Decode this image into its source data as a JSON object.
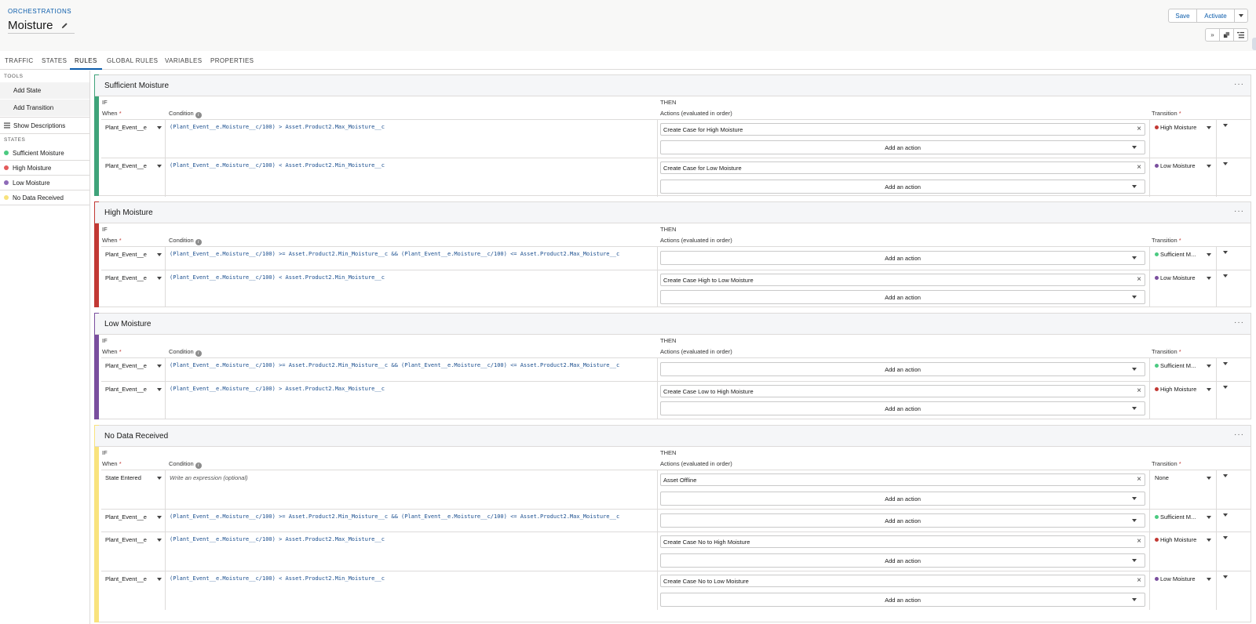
{
  "header": {
    "breadcrumb": "ORCHESTRATIONS",
    "title": "Moisture",
    "save_label": "Save",
    "activate_label": "Activate"
  },
  "tabs": [
    {
      "label": "TRAFFIC"
    },
    {
      "label": "STATES"
    },
    {
      "label": "RULES"
    },
    {
      "label": "GLOBAL RULES"
    },
    {
      "label": "VARIABLES"
    },
    {
      "label": "PROPERTIES"
    }
  ],
  "sidebar": {
    "tools_heading": "TOOLS",
    "add_state": "Add State",
    "add_transition": "Add Transition",
    "show_descriptions": "Show Descriptions",
    "states_heading": "STATES",
    "states": [
      {
        "label": "Sufficient Moisture",
        "color": "#4bca81"
      },
      {
        "label": "High Moisture",
        "color": "#e35b5b"
      },
      {
        "label": "Low Moisture",
        "color": "#8e6bb8"
      },
      {
        "label": "No Data Received",
        "color": "#f8e27b"
      }
    ]
  },
  "labels": {
    "if": "IF",
    "then": "THEN",
    "when": "When",
    "condition": "Condition",
    "actions": "Actions (evaluated in order)",
    "transition": "Transition",
    "add_action": "Add an action",
    "required": "*"
  },
  "colors": {
    "sufficient": "#3fa37a",
    "high": "#c23934",
    "low": "#7a4f9e",
    "nodata": "#f9e37d",
    "accent": "#0b5cab"
  },
  "cards": [
    {
      "title": "Sufficient Moisture",
      "rules": [
        {
          "when": "Plant_Event__e",
          "condition": "(Plant_Event__e.Moisture__c/100) > Asset.Product2.Max_Moisture__c",
          "action": "Create Case for High Moisture",
          "transition": "High Moisture"
        },
        {
          "when": "Plant_Event__e",
          "condition": "(Plant_Event__e.Moisture__c/100) < Asset.Product2.Min_Moisture__c",
          "action": "Create Case for Low Moisture",
          "transition": "Low Moisture"
        }
      ]
    },
    {
      "title": "High Moisture",
      "rules": [
        {
          "when": "Plant_Event__e",
          "condition": "(Plant_Event__e.Moisture__c/100) >= Asset.Product2.Min_Moisture__c && (Plant_Event__e.Moisture__c/100) <= Asset.Product2.Max_Moisture__c",
          "action": "",
          "transition": "Sufficient M..."
        },
        {
          "when": "Plant_Event__e",
          "condition": "(Plant_Event__e.Moisture__c/100) < Asset.Product2.Min_Moisture__c",
          "action": "Create Case High to Low Moisture",
          "transition": "Low Moisture"
        }
      ]
    },
    {
      "title": "Low Moisture",
      "rules": [
        {
          "when": "Plant_Event__e",
          "condition": "(Plant_Event__e.Moisture__c/100) >= Asset.Product2.Min_Moisture__c && (Plant_Event__e.Moisture__c/100) <= Asset.Product2.Max_Moisture__c",
          "action": "",
          "transition": "Sufficient M..."
        },
        {
          "when": "Plant_Event__e",
          "condition": "(Plant_Event__e.Moisture__c/100) > Asset.Product2.Max_Moisture__c",
          "action": "Create Case Low to High Moisture",
          "transition": "High Moisture"
        }
      ]
    },
    {
      "title": "No Data Received",
      "rules": [
        {
          "when": "State Entered",
          "condition": "",
          "condition_placeholder": "Write an expression (optional)",
          "action": "Asset Offline",
          "transition": "None"
        },
        {
          "when": "Plant_Event__e",
          "condition": "(Plant_Event__e.Moisture__c/100) >= Asset.Product2.Min_Moisture__c && (Plant_Event__e.Moisture__c/100) <= Asset.Product2.Max_Moisture__c",
          "action": "",
          "transition": "Sufficient M..."
        },
        {
          "when": "Plant_Event__e",
          "condition": "(Plant_Event__e.Moisture__c/100) > Asset.Product2.Max_Moisture__c",
          "action": "Create Case No to High Moisture",
          "transition": "High Moisture"
        },
        {
          "when": "Plant_Event__e",
          "condition": "(Plant_Event__e.Moisture__c/100) < Asset.Product2.Min_Moisture__c",
          "action": "Create Case No to Low Moisture",
          "transition": "Low Moisture"
        }
      ]
    }
  ]
}
